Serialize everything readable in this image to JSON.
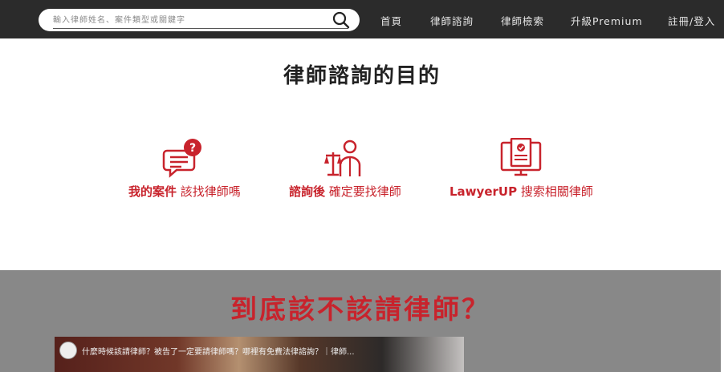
{
  "header": {
    "search": {
      "placeholder": "輸入律師姓名、案件類型或關鍵字",
      "value": ""
    },
    "nav": [
      {
        "label": "首頁"
      },
      {
        "label": "律師諮詢"
      },
      {
        "label": "律師檢索"
      },
      {
        "label": "升級Premium"
      },
      {
        "label": "註冊/登入"
      }
    ]
  },
  "purpose": {
    "title": "律師諮詢的目的",
    "features": [
      {
        "bold": "我的案件",
        "rest": " 該找律師嗎",
        "icon": "chat-question-icon"
      },
      {
        "bold": "諮詢後",
        "rest": " 確定要找律師",
        "icon": "lawyer-scales-icon"
      },
      {
        "bold": "LawyerUP",
        "rest": " 搜索相關律師",
        "icon": "monitor-document-icon"
      }
    ]
  },
  "hire": {
    "title": "到底該不該請律師？",
    "video": {
      "title": "什麼時候該請律師？被告了一定要請律師嗎？哪裡有免費法律諮詢？｜律師..."
    }
  },
  "colors": {
    "accent": "#c8232c",
    "topbar": "#2b2b2b",
    "section_bg": "#888888"
  }
}
